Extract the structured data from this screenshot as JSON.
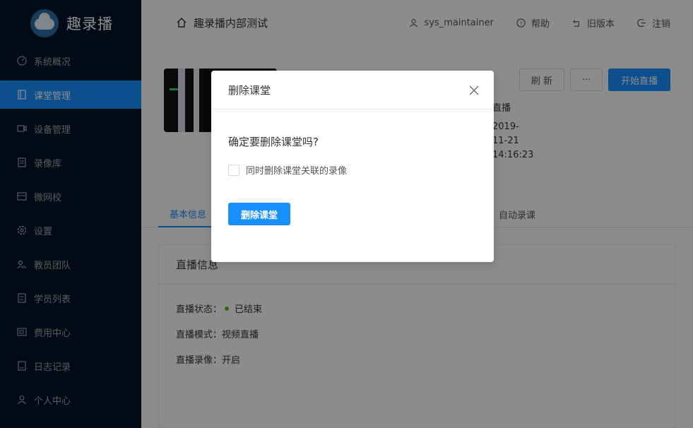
{
  "brand": {
    "name": "趣录播"
  },
  "sidebar": {
    "items": [
      {
        "label": "系统概况",
        "icon": "dashboard-icon"
      },
      {
        "label": "课堂管理",
        "icon": "book-icon",
        "active": true
      },
      {
        "label": "设备管理",
        "icon": "camera-icon"
      },
      {
        "label": "录像库",
        "icon": "archive-icon"
      },
      {
        "label": "微网校",
        "icon": "school-icon"
      },
      {
        "label": "设置",
        "icon": "gear-icon"
      },
      {
        "label": "教员团队",
        "icon": "team-icon"
      },
      {
        "label": "学员列表",
        "icon": "list-icon"
      },
      {
        "label": "费用中心",
        "icon": "wallet-icon"
      },
      {
        "label": "日志记录",
        "icon": "log-icon"
      },
      {
        "label": "个人中心",
        "icon": "user-icon"
      }
    ]
  },
  "header": {
    "title": "趣录播内部测试",
    "user": "sys_maintainer",
    "help": "帮助",
    "old_version": "旧版本",
    "logout": "注销"
  },
  "toolbar": {
    "refresh": "刷 新",
    "more": "···",
    "start_live": "开始直播"
  },
  "side_info": {
    "status": "直播",
    "date_line1": "2019-",
    "date_line2": "11-21",
    "time": "14:16:23"
  },
  "tabs": {
    "basic": "基本信息",
    "auto_record": "自动录课"
  },
  "card": {
    "title": "直播信息",
    "status_label": "直播状态：",
    "status_value": "已结束",
    "mode_label": "直播模式：",
    "mode_value": "视频直播",
    "record_label": "直播录像：",
    "record_value": "开启"
  },
  "colors": {
    "accent": "#1890ff",
    "sidebar_bg": "#001529",
    "status_ended": "#52c41a"
  },
  "modal": {
    "title": "删除课堂",
    "question": "确定要删除课堂吗?",
    "checkbox_label": "同时删除课堂关联的录像",
    "checkbox_checked": false,
    "confirm": "删除课堂"
  }
}
